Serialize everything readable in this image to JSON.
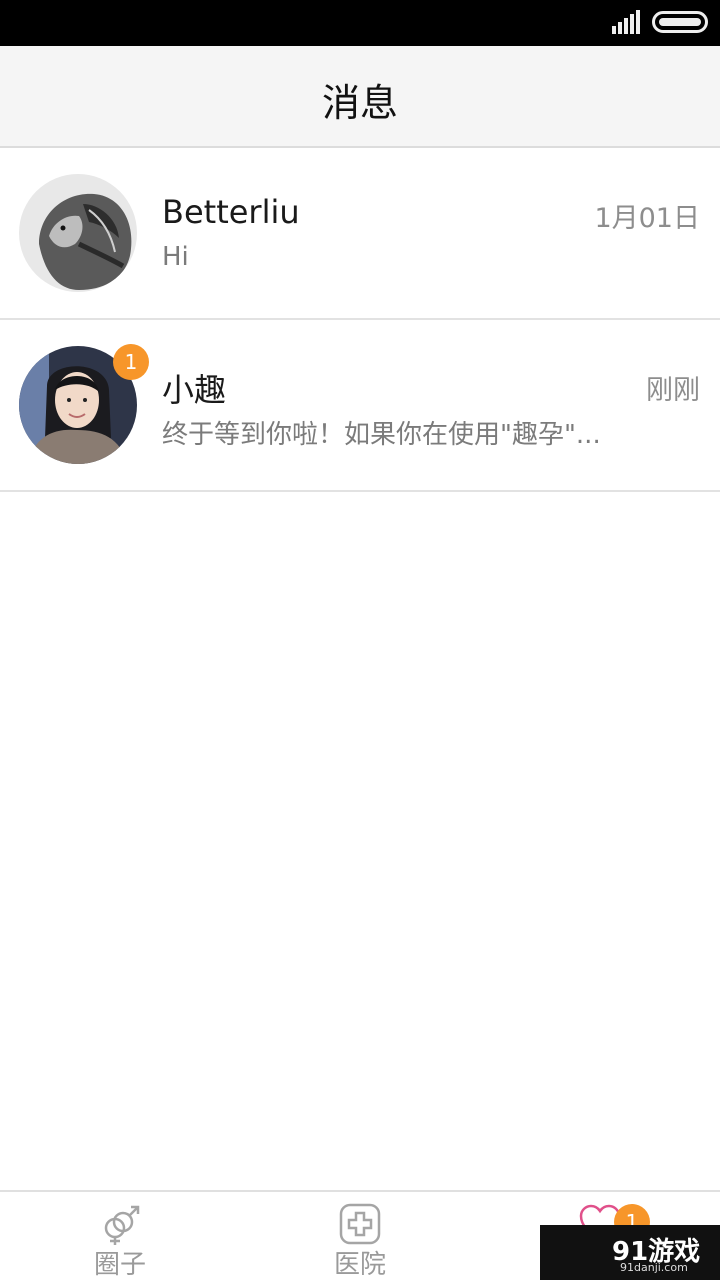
{
  "nav": {
    "title": "消息"
  },
  "conversations": [
    {
      "name": "Betterliu",
      "time": "1月01日",
      "preview": "Hi",
      "avatar": "lion-photo"
    },
    {
      "name": "小趣",
      "time": "刚刚",
      "preview": "终于等到你啦！如果你在使用\"趣孕\"...",
      "unread": "1",
      "avatar": "woman-photo"
    }
  ],
  "tabs": [
    {
      "label": "圈子",
      "icon": "gender-icon"
    },
    {
      "label": "医院",
      "icon": "hospital-plus-icon"
    },
    {
      "label": "",
      "icon": "heart-chat-icon",
      "badge": "1",
      "active": true
    }
  ],
  "watermark": {
    "logo": "91游戏",
    "url": "91danji.com"
  },
  "colors": {
    "badge": "#f7962a",
    "nav_bg": "#f5f5f5",
    "active_tab": "#e0508a"
  }
}
